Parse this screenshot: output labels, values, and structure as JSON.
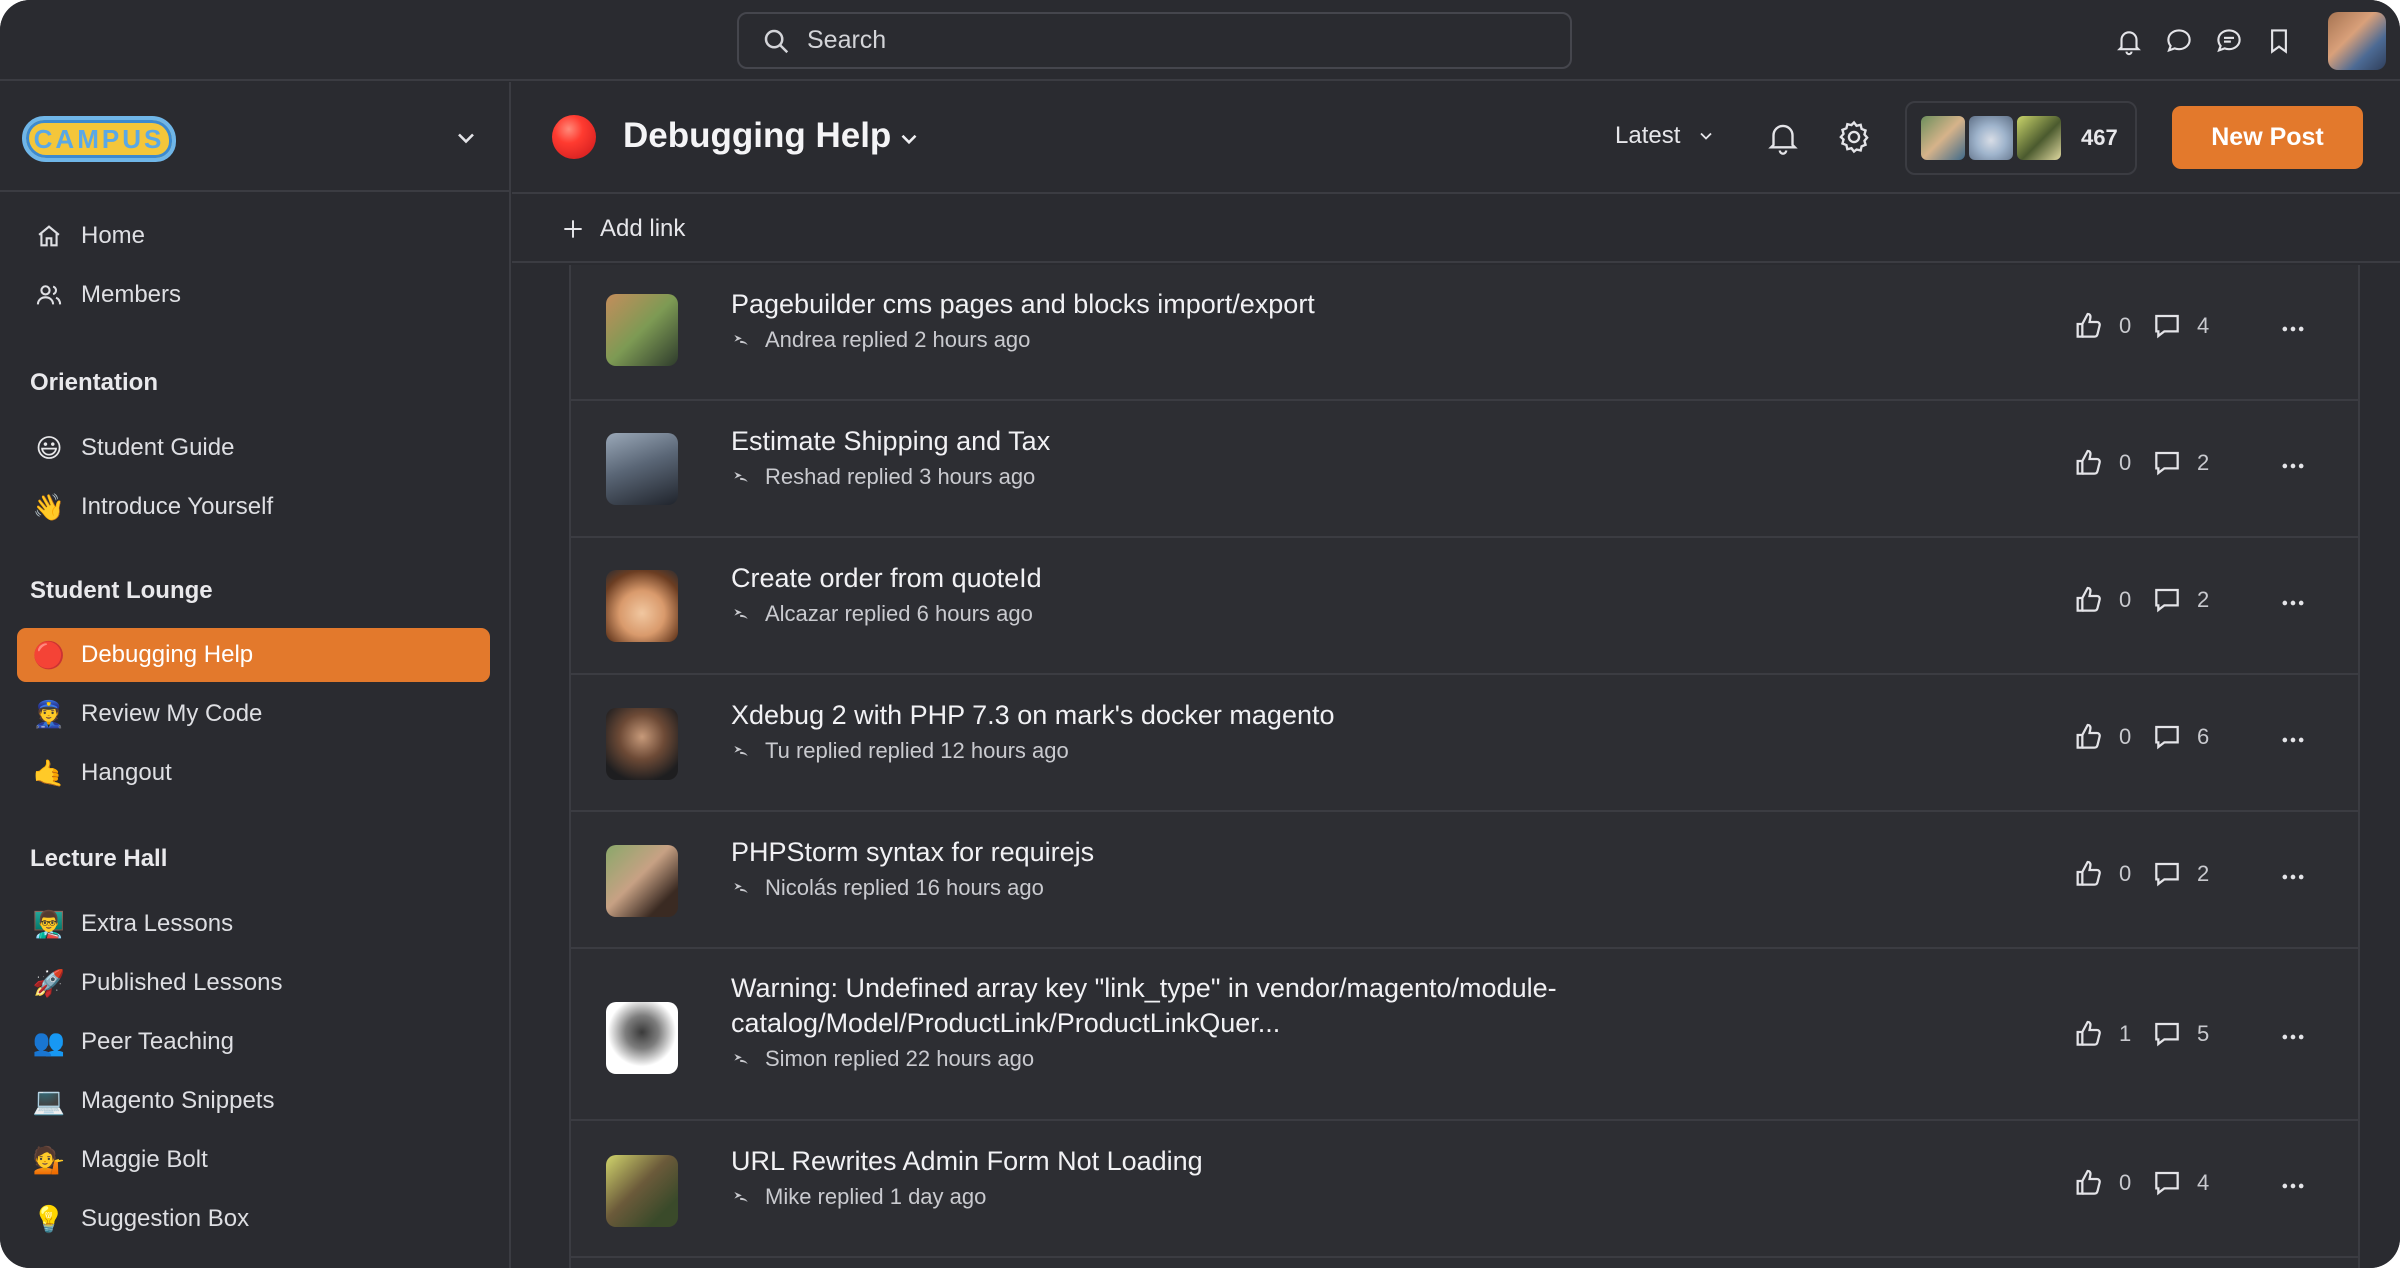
{
  "search": {
    "placeholder": "Search"
  },
  "brand": {
    "logo_text": "CAMPUS"
  },
  "sidebar": {
    "top_items": [
      {
        "label": "Home",
        "icon": "home-icon"
      },
      {
        "label": "Members",
        "icon": "members-icon"
      }
    ],
    "sections": [
      {
        "title": "Orientation",
        "items": [
          {
            "label": "Student Guide",
            "emoji": "😃"
          },
          {
            "label": "Introduce Yourself",
            "emoji": "👋"
          }
        ]
      },
      {
        "title": "Student Lounge",
        "items": [
          {
            "label": "Debugging Help",
            "emoji": "🔴",
            "active": true
          },
          {
            "label": "Review My Code",
            "emoji": "👮"
          },
          {
            "label": "Hangout",
            "emoji": "🤙"
          }
        ]
      },
      {
        "title": "Lecture Hall",
        "items": [
          {
            "label": "Extra Lessons",
            "emoji": "👨‍🏫"
          },
          {
            "label": "Published Lessons",
            "emoji": "🚀"
          },
          {
            "label": "Peer Teaching",
            "emoji": "👥"
          },
          {
            "label": "Magento Snippets",
            "emoji": "💻"
          },
          {
            "label": "Maggie Bolt",
            "emoji": "💁"
          },
          {
            "label": "Suggestion Box",
            "emoji": "💡"
          }
        ]
      }
    ]
  },
  "header": {
    "space_title": "Debugging Help",
    "sort_label": "Latest",
    "member_count": "467",
    "new_post_label": "New Post",
    "add_link_label": "Add link"
  },
  "posts": [
    {
      "title": "Pagebuilder cms pages and blocks import/export",
      "meta": "Andrea replied 2 hours ago",
      "likes": "0",
      "comments": "4"
    },
    {
      "title": "Estimate Shipping and Tax",
      "meta": "Reshad replied 3 hours ago",
      "likes": "0",
      "comments": "2"
    },
    {
      "title": "Create order from quoteId",
      "meta": "Alcazar replied 6 hours ago",
      "likes": "0",
      "comments": "2"
    },
    {
      "title": "Xdebug 2 with PHP 7.3 on mark's docker magento",
      "meta": "Tu replied replied 12 hours ago",
      "likes": "0",
      "comments": "6"
    },
    {
      "title": "PHPStorm syntax for requirejs",
      "meta": "Nicolás replied 16 hours ago",
      "likes": "0",
      "comments": "2"
    },
    {
      "title": "Warning: Undefined array key \"link_type\" in vendor/magento/module-catalog/Model/ProductLink/ProductLinkQuer...",
      "meta": "Simon replied 22 hours ago",
      "likes": "1",
      "comments": "5"
    },
    {
      "title": "URL Rewrites Admin Form Not Loading",
      "meta": "Mike replied 1 day ago",
      "likes": "0",
      "comments": "4"
    }
  ]
}
